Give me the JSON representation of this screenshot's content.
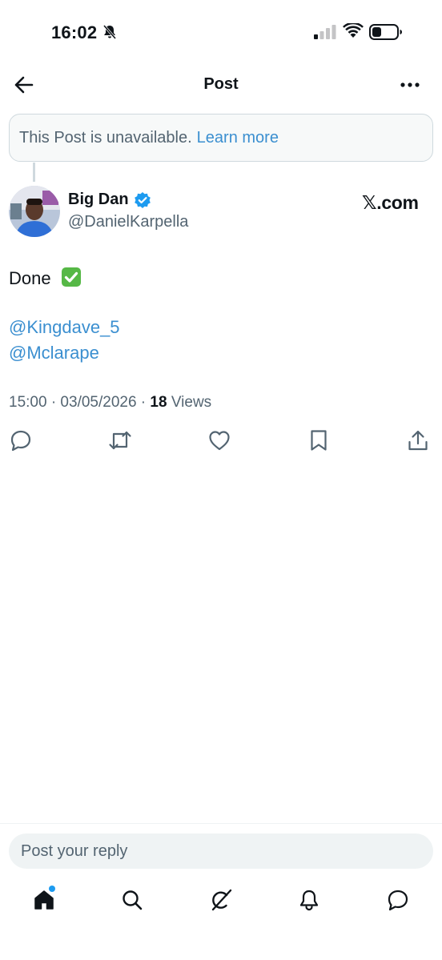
{
  "status_bar": {
    "time": "16:02"
  },
  "header": {
    "title": "Post"
  },
  "notice": {
    "text": "This Post is unavailable.",
    "link": "Learn more"
  },
  "post": {
    "display_name": "Big Dan",
    "handle": "@DanielKarpella",
    "source_label": "𝕏.com",
    "text": "Done",
    "mentions": [
      "@Kingdave_5",
      "@Mclarape"
    ],
    "timestamp": "15:00 · 03/05/2026 · ",
    "views_count": "18",
    "views_label": " Views"
  },
  "reply": {
    "placeholder": "Post your reply"
  },
  "colors": {
    "accent": "#1d9bf0",
    "link": "#3b8fd0",
    "text": "#0f1419",
    "muted": "#536471",
    "check": "#56b846"
  },
  "icons": [
    "back-arrow-icon",
    "more-dots-icon",
    "verified-badge-icon",
    "check-mark-emoji",
    "reply-icon",
    "repost-icon",
    "like-icon",
    "bookmark-icon",
    "share-icon",
    "home-icon",
    "search-icon",
    "grok-icon",
    "bell-icon",
    "messages-icon"
  ]
}
